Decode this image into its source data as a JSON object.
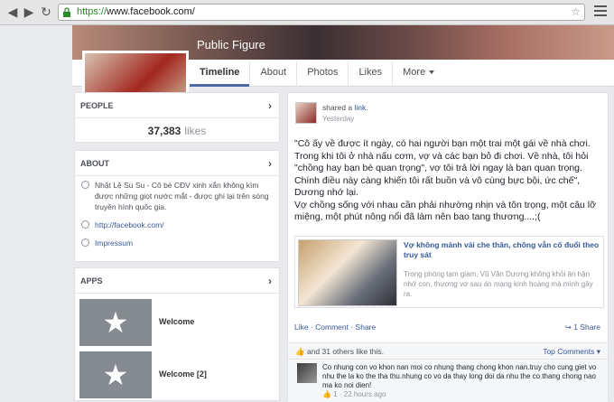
{
  "browser": {
    "url_https": "https://",
    "url_rest": "www.facebook.com/"
  },
  "profile": {
    "category": "Public Figure"
  },
  "tabs": [
    {
      "label": "Timeline"
    },
    {
      "label": "About"
    },
    {
      "label": "Photos"
    },
    {
      "label": "Likes"
    },
    {
      "label": "More"
    }
  ],
  "people": {
    "title": "PEOPLE",
    "count": "37,383",
    "unit": "likes"
  },
  "about": {
    "title": "ABOUT",
    "bio": "Nhật Lệ Su Su - Cô bé CĐV xinh xắn không kìm được những giọt nước mắt - được ghi lại trên sóng truyền hình quốc gia.",
    "link": "http://facebook.com/",
    "impressum": "Impressum"
  },
  "apps": {
    "title": "APPS",
    "items": [
      {
        "label": "Welcome"
      },
      {
        "label": "Welcome [2]"
      }
    ]
  },
  "post": {
    "shared": "shared a",
    "link": "link",
    "time": "Yesterday",
    "body": "\"Cô ấy về được ít ngày, có hai người bạn một trai một gái về nhà chơi. Trong khi tôi ở nhà nấu cơm, vợ và các bạn bỏ đi chơi. Về nhà, tôi hỏi \"chồng hay bạn bè quan trọng\", vợ tôi trả lời ngay là bạn quan trọng. Chính điều này càng khiến tôi rất buồn và vô cùng bực bội, ức chế\", Dương nhớ lại.\nVợ chồng sống với nhau cần phải nhường nhịn và tôn trọng, một câu lỡ miệng, một phút nông nổi đã làm nên bao tang thương....;(",
    "attach_title": "Vợ không mảnh vải che thân, chồng vẫn cố đuổi theo truy sát",
    "attach_desc": "Trong phòng tạm giam, Vũ Văn Dương không khỏi ân hận nhớ con, thương vợ sau án mạng kinh hoàng mà mình gây ra.",
    "actions": "Like · Comment · Share",
    "share_count": "1 Share",
    "likes_line": "and 31 others like this.",
    "top_comments": "Top Comments ▾",
    "comment": "Co nhung con vo khon nan moi co nhung thang chong khon nan.truy cho cung giet vo nhu the la ko the tha thu.nhung co vo da thay long doi da nhu the co thang chong nao ma ko noi dien!",
    "comment_meta": "1 · 22 hours ago"
  }
}
